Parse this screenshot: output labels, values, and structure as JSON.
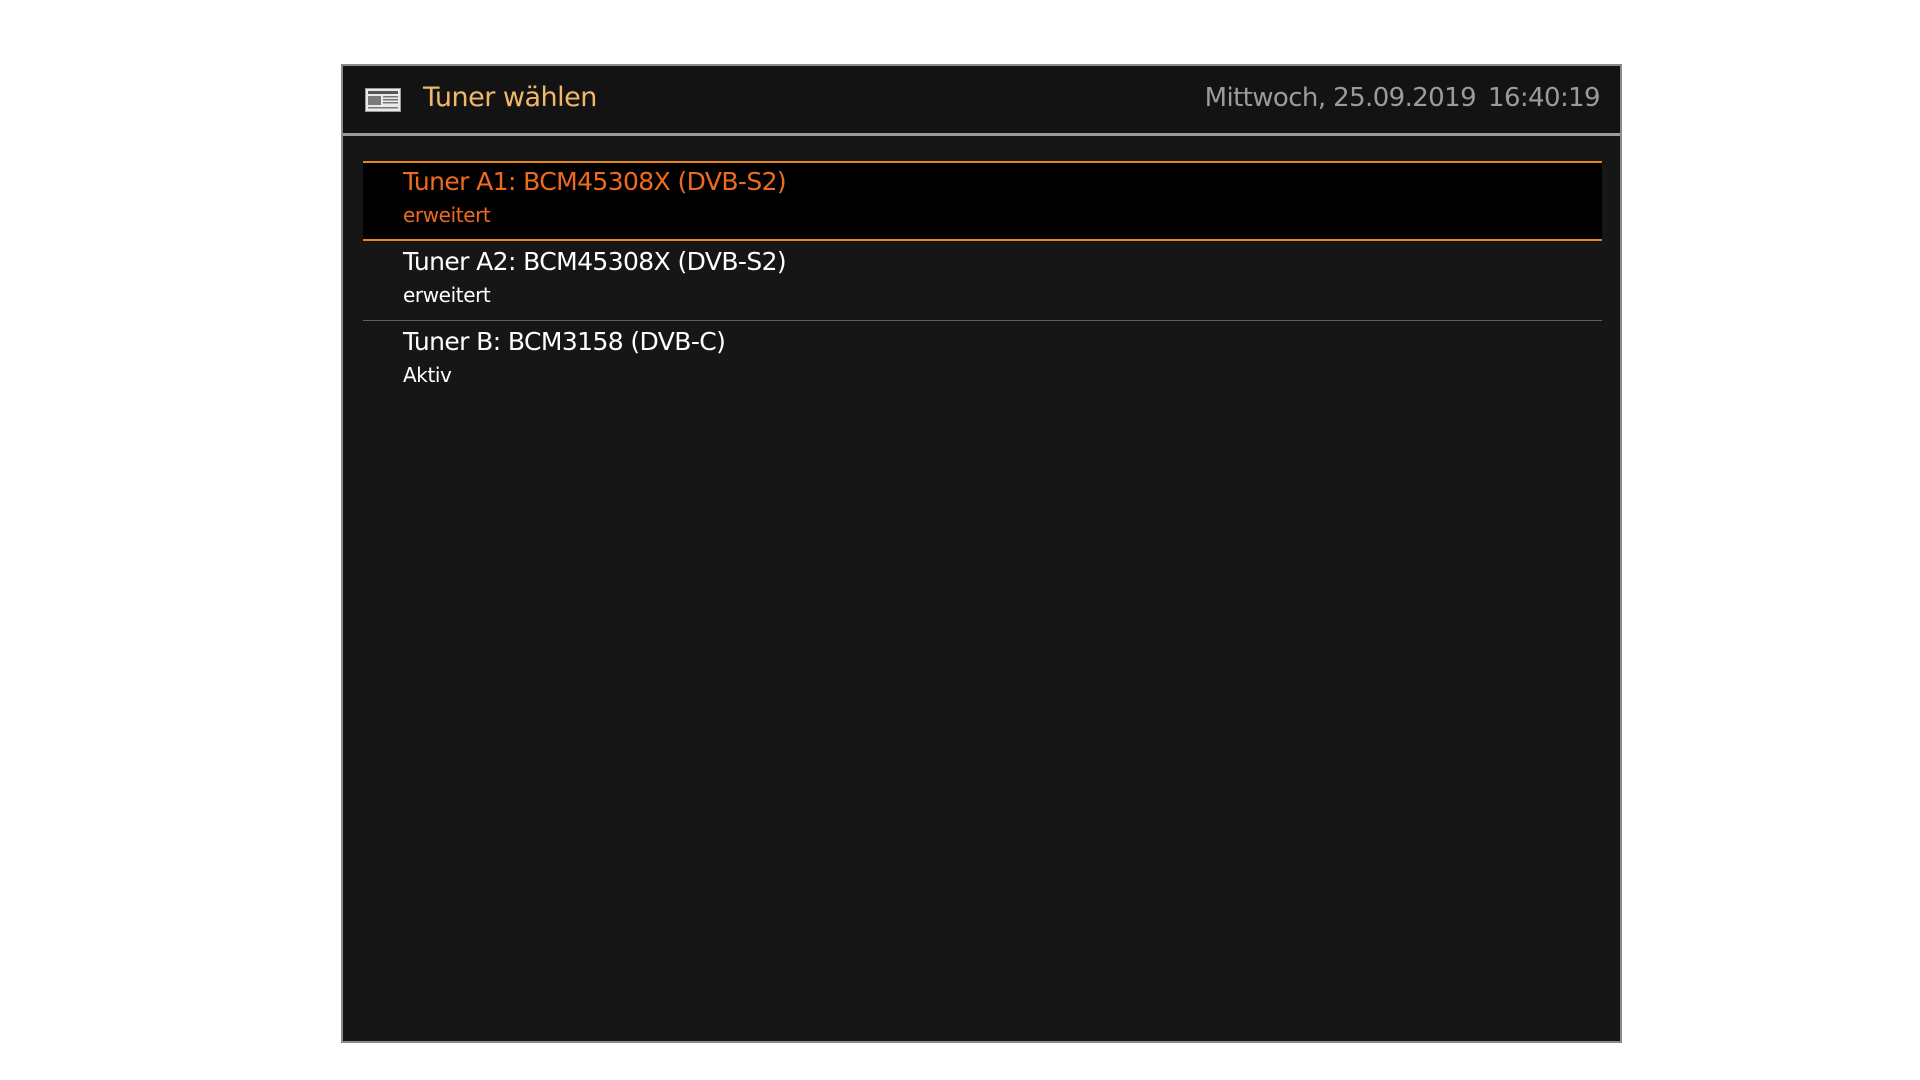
{
  "window": {
    "title": "Tuner wählen",
    "icon": "newspaper-icon"
  },
  "clock": {
    "date": "Mittwoch, 25.09.2019",
    "time": "16:40:19"
  },
  "colors": {
    "accent": "#e8841e",
    "selected_text": "#ef6a1c",
    "title_text": "#f0b868",
    "clock_text": "#9b9b9b",
    "background": "#161616"
  },
  "tuners": [
    {
      "name": "Tuner A1: BCM45308X (DVB-S2)",
      "status": "erweitert",
      "selected": true
    },
    {
      "name": "Tuner A2: BCM45308X (DVB-S2)",
      "status": "erweitert",
      "selected": false
    },
    {
      "name": "Tuner B: BCM3158 (DVB-C)",
      "status": "Aktiv",
      "selected": false
    }
  ]
}
